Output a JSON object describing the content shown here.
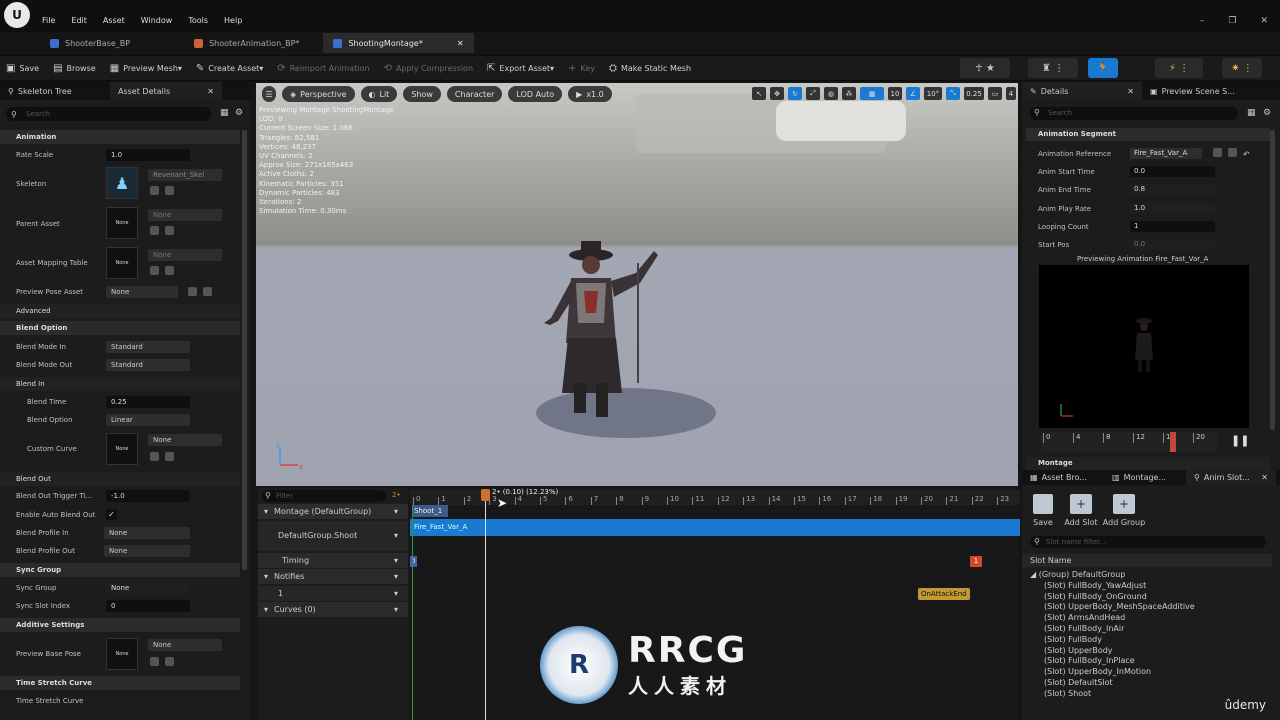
{
  "menu": {
    "items": [
      "File",
      "Edit",
      "Asset",
      "Window",
      "Tools",
      "Help"
    ],
    "logo": "U"
  },
  "tabs": [
    {
      "label": "ShooterBase_BP",
      "color": "#3b6fcf"
    },
    {
      "label": "ShooterAnimation_BP*",
      "color": "#d0603a"
    },
    {
      "label": "ShootingMontage*",
      "color": "#3b6fcf"
    }
  ],
  "toolbar": {
    "save": "Save",
    "browse": "Browse",
    "preview_mesh": "Preview Mesh",
    "create_asset": "Create Asset",
    "reimport": "Reimport Animation",
    "apply_compression": "Apply Compression",
    "export_asset": "Export Asset",
    "key": "Key",
    "make_static_mesh": "Make Static Mesh"
  },
  "left": {
    "tabs": [
      "Skeleton Tree",
      "Asset Details"
    ],
    "search": "Search",
    "sections": {
      "animation": "Animation",
      "advanced": "Advanced",
      "blend_option": "Blend Option",
      "blend_in": "Blend In",
      "blend_out": "Blend Out",
      "sync_group": "Sync Group",
      "additive": "Additive Settings",
      "time_stretch": "Time Stretch Curve"
    },
    "props": {
      "rate_scale": {
        "label": "Rate Scale",
        "value": "1.0"
      },
      "skeleton": {
        "label": "Skeleton",
        "value": "Revenant_Skel"
      },
      "parent_asset": {
        "label": "Parent Asset",
        "thumb": "None",
        "value": "None"
      },
      "mapping": {
        "label": "Asset Mapping Table",
        "thumb": "None",
        "value": "None"
      },
      "preview_pose": {
        "label": "Preview Pose Asset",
        "value": "None"
      },
      "blend_mode_in": {
        "label": "Blend Mode In",
        "value": "Standard"
      },
      "blend_mode_out": {
        "label": "Blend Mode Out",
        "value": "Standard"
      },
      "blend_time": {
        "label": "Blend Time",
        "value": "0.25"
      },
      "blend_option": {
        "label": "Blend Option",
        "value": "Linear"
      },
      "custom_curve": {
        "label": "Custom Curve",
        "thumb": "None",
        "value": "None"
      },
      "blend_out_trigger": {
        "label": "Blend Out Trigger Ti...",
        "value": "-1.0"
      },
      "auto_blend_out": {
        "label": "Enable Auto Blend Out"
      },
      "profile_in": {
        "label": "Blend Profile In",
        "value": "None"
      },
      "profile_out": {
        "label": "Blend Profile Out",
        "value": "None"
      },
      "sync_group": {
        "label": "Sync Group",
        "value": "None"
      },
      "sync_slot": {
        "label": "Sync Slot Index",
        "value": "0"
      },
      "preview_base": {
        "label": "Preview Base Pose",
        "thumb": "None",
        "value": "None"
      },
      "time_stretch": {
        "label": "Time Stretch Curve"
      }
    }
  },
  "viewport": {
    "buttons": [
      "Perspective",
      "Lit",
      "Show",
      "Character",
      "LOD Auto",
      "x1.0"
    ],
    "stats": [
      "Previewing Montage ShootingMontage",
      "LOD: 0",
      "Current Screen Size: 1.066",
      "Triangles: 82,581",
      "Vertices: 48,237",
      "UV Channels: 2",
      "Approx Size: 271x185x463",
      "Active Cloths: 2",
      "Kinematic Particles: 351",
      "Dynamic Particles: 483",
      "Iterations: 2",
      "Simulation Time: 0.30ms"
    ],
    "right_icons": {
      "grid": "10",
      "angle": "10°",
      "scale": "0.25",
      "camera": "4"
    }
  },
  "timeline": {
    "filter": "Filter",
    "frame_badge": "2•",
    "playhead": "2• (0.10) (12.23%)",
    "ticks": [
      "0",
      "1",
      "2",
      "3",
      "4",
      "5",
      "6",
      "7",
      "8",
      "9",
      "10",
      "11",
      "12",
      "13",
      "14",
      "15",
      "16",
      "17",
      "18",
      "19",
      "20",
      "21",
      "22",
      "23"
    ],
    "rows": {
      "montage": "Montage (DefaultGroup)",
      "slot": "DefaultGroup.Shoot",
      "timing": "Timing",
      "notifies": "Notifies",
      "notify_track": "1",
      "curves": "Curves (0)"
    },
    "section": "Shoot_1",
    "clip": "Fire_Fast_Var_A",
    "timing_marker_left": "0",
    "timing_marker_right": "1",
    "notify": "OnAttackEnd"
  },
  "right": {
    "tabs": [
      "Details",
      "Preview Scene S..."
    ],
    "search": "Search",
    "section": "Animation Segment",
    "props": {
      "anim_ref": {
        "label": "Animation Reference",
        "value": "Fire_Fast_Var_A"
      },
      "start_time": {
        "label": "Anim Start Time",
        "value": "0.0"
      },
      "end_time": {
        "label": "Anim End Time",
        "value": "0.8"
      },
      "play_rate": {
        "label": "Anim Play Rate",
        "value": "1.0"
      },
      "looping": {
        "label": "Looping Count",
        "value": "1"
      },
      "start_pos": {
        "label": "Start Pos",
        "value": "0.0"
      }
    },
    "preview_label": "Previewing Animation Fire_Fast_Var_A",
    "scrub_ticks": [
      "0",
      "4",
      "8",
      "12",
      "16",
      "20"
    ],
    "montage_section": "Montage",
    "bottom_tabs": [
      "Asset Bro...",
      "Montage...",
      "Anim Slot..."
    ],
    "slot_buttons": [
      "Save",
      "Add Slot",
      "Add Group"
    ],
    "slot_filter": "Slot name filter...",
    "slot_header": "Slot Name",
    "group": "(Group) DefaultGroup",
    "slots": [
      "(Slot) FullBody_YawAdjust",
      "(Slot) FullBody_OnGround",
      "(Slot) UpperBody_MeshSpaceAdditive",
      "(Slot) ArmsAndHead",
      "(Slot) FullBody_InAir",
      "(Slot) FullBody",
      "(Slot) UpperBody",
      "(Slot) FullBody_InPlace",
      "(Slot) UpperBody_InMotion",
      "(Slot) DefaultSlot",
      "(Slot) Shoot"
    ]
  },
  "watermark": {
    "logo": "R",
    "big": "RRCG",
    "small": "人人素材",
    "udemy": "ûdemy"
  }
}
